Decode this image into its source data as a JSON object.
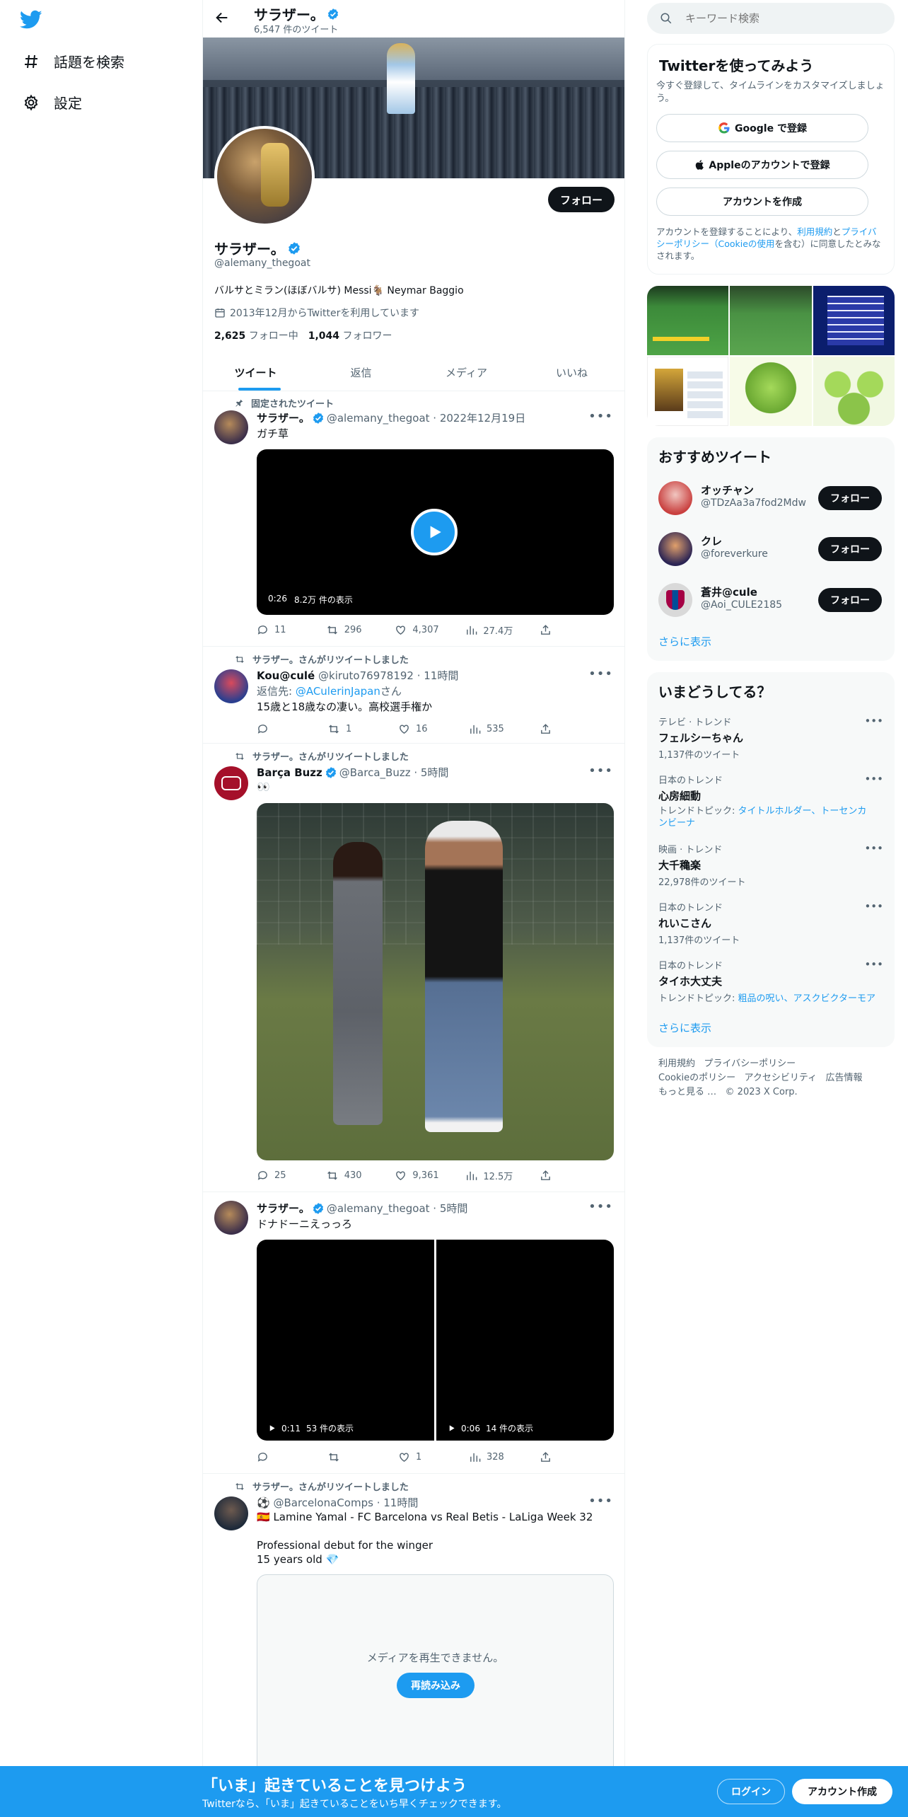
{
  "nav": {
    "explore": "話題を検索",
    "settings": "設定"
  },
  "header": {
    "name": "サラザー。",
    "tweet_count": "6,547 件のツイート"
  },
  "profile": {
    "follow": "フォロー",
    "name": "サラザー。",
    "handle": "@alemany_thegoat",
    "bio": "バルサとミラン(ほぼバルサ) Messi🐐 Neymar Baggio",
    "joined": "2013年12月からTwitterを利用しています",
    "following_count": "2,625",
    "following_label": "フォロー中",
    "followers_count": "1,044",
    "followers_label": "フォロワー"
  },
  "tabs": [
    "ツイート",
    "返信",
    "メディア",
    "いいね"
  ],
  "tweets": [
    {
      "pinned": "固定されたツイート",
      "name": "サラザー。",
      "handle": "@alemany_thegoat",
      "date": "2022年12月19日",
      "text": "ガチ草",
      "video_time": "0:26",
      "video_views": "8.2万 件の表示",
      "replies": "11",
      "retweets": "296",
      "likes": "4,307",
      "views": "27.4万"
    },
    {
      "rt": "サラザー。さんがリツイートしました",
      "name": "Kou@culé",
      "handle": "@kiruto76978192",
      "date": "11時間",
      "reply_to_prefix": "返信先: ",
      "reply_to": "@ACulerinJapan",
      "reply_to_suffix": "さん",
      "text": "15歳と18歳なの凄い。高校選手権か",
      "replies": "",
      "retweets": "1",
      "likes": "16",
      "views": "535"
    },
    {
      "rt": "サラザー。さんがリツイートしました",
      "name": "Barça Buzz",
      "handle": "@Barca_Buzz",
      "date": "5時間",
      "text": "👀",
      "replies": "25",
      "retweets": "430",
      "likes": "9,361",
      "views": "12.5万"
    },
    {
      "name": "サラザー。",
      "handle": "@alemany_thegoat",
      "date": "5時間",
      "text": "ドナドーニえっっろ",
      "v1_time": "0:11",
      "v1_views": "53 件の表示",
      "v2_time": "0:06",
      "v2_views": "14 件の表示",
      "replies": "",
      "retweets": "",
      "likes": "1",
      "views": "328"
    },
    {
      "rt": "サラザー。さんがリツイートしました",
      "name": "⚽",
      "handle": "@BarcelonaComps",
      "date": "11時間",
      "line1": "🇪🇸 Lamine Yamal - FC Barcelona vs Real Betis - LaLiga Week 32",
      "line2": "Professional debut for the winger",
      "line3": "15 years old 💎",
      "media_error": "メディアを再生できません。",
      "reload": "再読み込み"
    }
  ],
  "search": {
    "placeholder": "キーワード検索"
  },
  "signup": {
    "title": "Twitterを使ってみよう",
    "subtitle": "今すぐ登録して、タイムラインをカスタマイズしましょう。",
    "google": "Google で登録",
    "apple": "Appleのアカウントで登録",
    "create": "アカウントを作成",
    "terms_prefix": "アカウントを登録することにより、",
    "terms": "利用規約",
    "and": "と",
    "privacy": "プライバシーポリシー（Cookieの使用",
    "terms_suffix": "を含む）に同意したとみなされます。"
  },
  "who_to_follow": {
    "title": "おすすめツイート",
    "users": [
      {
        "name": "オッチャン",
        "handle": "@TDzAa3a7fod2Mdw"
      },
      {
        "name": "クレ",
        "handle": "@foreverkure"
      },
      {
        "name": "蒼井@cule",
        "handle": "@Aoi_CULE2185"
      }
    ],
    "follow": "フォロー",
    "more": "さらに表示"
  },
  "trends": {
    "title": "いまどうしてる？",
    "items": [
      {
        "context": "テレビ · トレンド",
        "name": "フェルシーちゃん",
        "meta": "1,137件のツイート"
      },
      {
        "context": "日本のトレンド",
        "name": "心房細動",
        "meta_prefix": "トレンドトピック: ",
        "meta_link": "タイトルホルダー、トーセンカンビーナ"
      },
      {
        "context": "映画 · トレンド",
        "name": "大千穐楽",
        "meta": "22,978件のツイート"
      },
      {
        "context": "日本のトレンド",
        "name": "れいこさん",
        "meta": "1,137件のツイート"
      },
      {
        "context": "日本のトレンド",
        "name": "タイホ大丈夫",
        "meta_prefix": "トレンドトピック: ",
        "meta_link": "粗品の呪い、アスクビクターモア"
      }
    ],
    "more": "さらに表示"
  },
  "footer": {
    "l1": "利用規約",
    "l2": "プライバシーポリシー",
    "l3": "Cookieのポリシー",
    "l4": "アクセシビリティ",
    "l5": "広告情報",
    "l6": "もっと見る …",
    "l7": "© 2023 X Corp."
  },
  "bottom": {
    "title": "「いま」起きていることを見つけよう",
    "subtitle": "Twitterなら、「いま」起きていることをいち早くチェックできます。",
    "login": "ログイン",
    "signup": "アカウント作成"
  },
  "colors": {
    "accent": "#1d9bf0",
    "text": "#0f1419",
    "muted": "#536471"
  }
}
